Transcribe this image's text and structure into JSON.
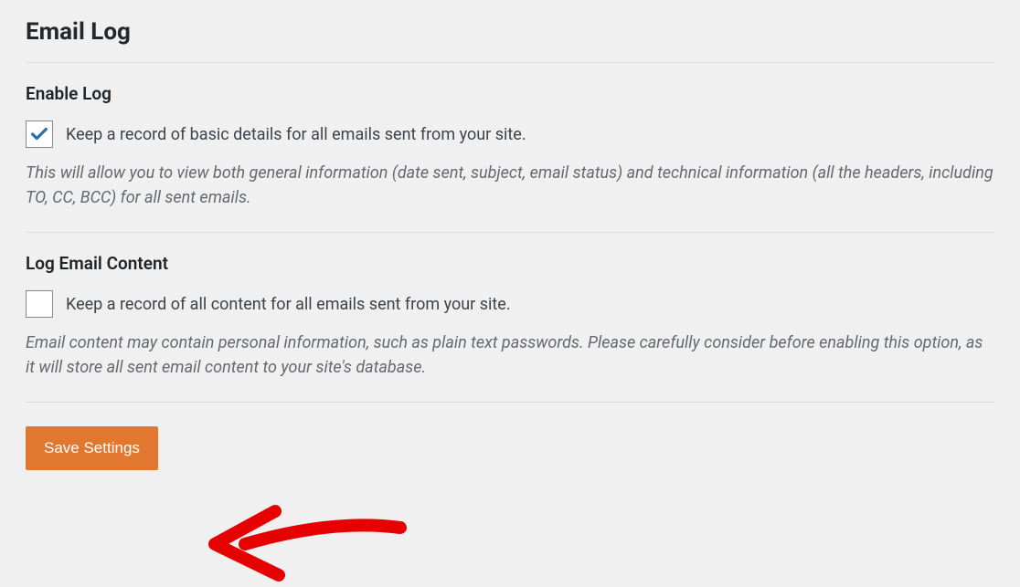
{
  "page": {
    "title": "Email Log"
  },
  "sections": {
    "enable_log": {
      "heading": "Enable Log",
      "checkbox_label": "Keep a record of basic details for all emails sent from your site.",
      "checked": true,
      "description": "This will allow you to view both general information (date sent, subject, email status) and technical information (all the headers, including TO, CC, BCC) for all sent emails."
    },
    "log_content": {
      "heading": "Log Email Content",
      "checkbox_label": "Keep a record of all content for all emails sent from your site.",
      "checked": false,
      "description": "Email content may contain personal information, such as plain text passwords. Please carefully consider before enabling this option, as it will store all sent email content to your site's database."
    }
  },
  "actions": {
    "save_label": "Save Settings"
  }
}
